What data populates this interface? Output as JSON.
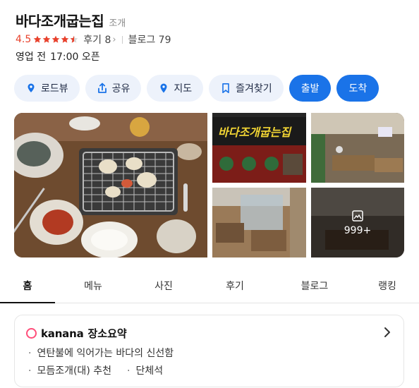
{
  "place": {
    "name": "바다조개굽는집",
    "category": "조개",
    "rating": "4.5",
    "review_label": "후기 8",
    "blog_label": "블로그 79",
    "status": "영업 전",
    "open_time": "17:00 오픈"
  },
  "rating_value": 4.5,
  "colors": {
    "accent": "#1a73e8",
    "rating": "#e8412c",
    "chip_bg": "#edf2fb",
    "kanana": "#ff4e7a"
  },
  "actions": [
    {
      "label": "로드뷰",
      "icon": "roadview-icon"
    },
    {
      "label": "공유",
      "icon": "share-icon"
    },
    {
      "label": "지도",
      "icon": "map-pin-icon"
    },
    {
      "label": "즐겨찾기",
      "icon": "bookmark-icon"
    },
    {
      "label": "출발"
    },
    {
      "label": "도착"
    }
  ],
  "gallery": {
    "more_count": "999+"
  },
  "tabs": [
    "홈",
    "메뉴",
    "사진",
    "후기",
    "블로그",
    "랭킹"
  ],
  "summary": {
    "brand": "kanana",
    "title": "장소요약",
    "bullets": [
      "연탄불에 익어가는 바다의 신선함",
      "모듬조개(대) 추천",
      "단체석"
    ]
  }
}
